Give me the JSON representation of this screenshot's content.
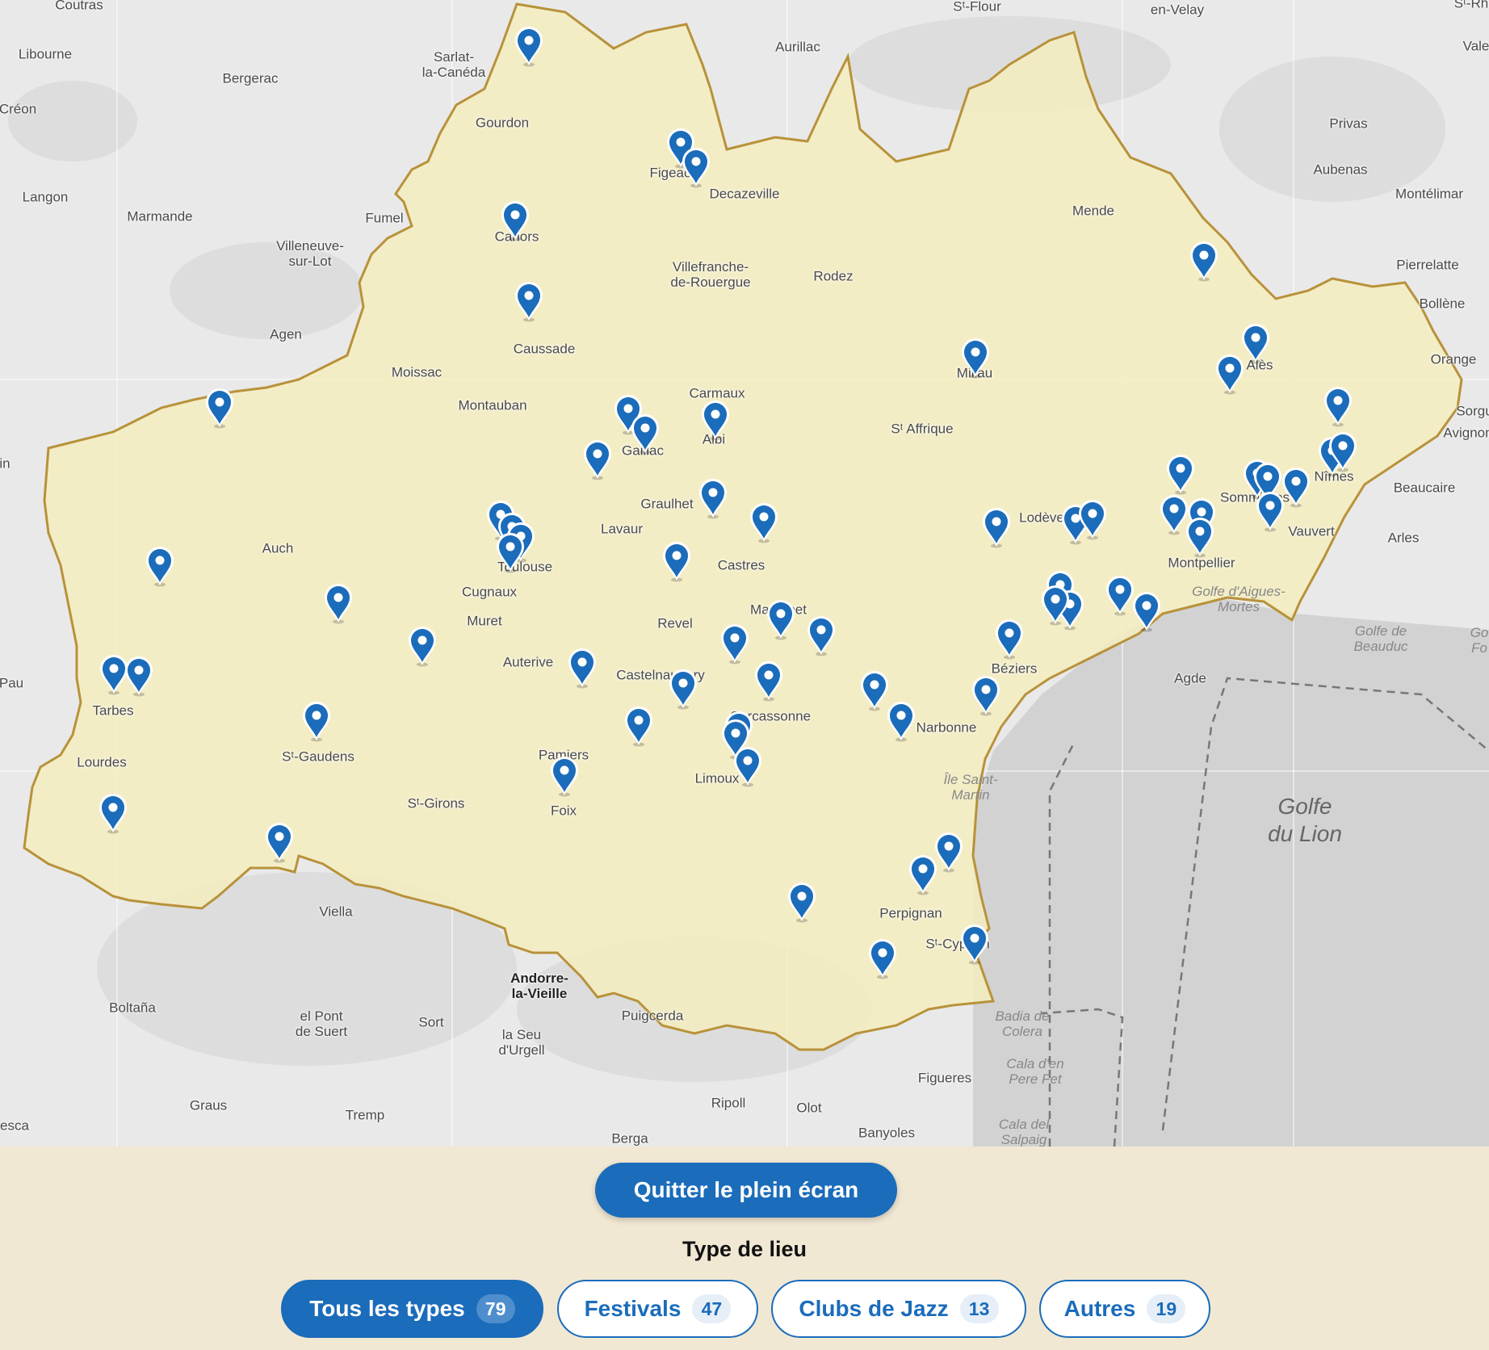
{
  "map": {
    "places": [
      {
        "name": "Coutras"
      },
      {
        "name": "Libourne"
      },
      {
        "name": "Créon"
      },
      {
        "name": "Bergerac"
      },
      {
        "name": "Sarlat-\nla-Canéda"
      },
      {
        "name": "Gourdon"
      },
      {
        "name": "Aurillac"
      },
      {
        "name": "Sᵗ-Flour"
      },
      {
        "name": "en-Velay"
      },
      {
        "name": "Privas"
      },
      {
        "name": "Aubenas"
      },
      {
        "name": "Montélimar"
      },
      {
        "name": "Langon"
      },
      {
        "name": "Marmande"
      },
      {
        "name": "Fumel"
      },
      {
        "name": "Villeneuve-\nsur-Lot"
      },
      {
        "name": "Figeac"
      },
      {
        "name": "Decazeville"
      },
      {
        "name": "Cahors"
      },
      {
        "name": "Villefranche-\nde-Rouergue"
      },
      {
        "name": "Rodez"
      },
      {
        "name": "Mende"
      },
      {
        "name": "Pierrelatte"
      },
      {
        "name": "Bollène"
      },
      {
        "name": "Orange"
      },
      {
        "name": "Agen"
      },
      {
        "name": "Caussade"
      },
      {
        "name": "Moissac"
      },
      {
        "name": "Montauban"
      },
      {
        "name": "Carmaux"
      },
      {
        "name": "Millau"
      },
      {
        "name": "Sᵗ Affrique"
      },
      {
        "name": "Avignon"
      },
      {
        "name": "Auch"
      },
      {
        "name": "Lavaur"
      },
      {
        "name": "Graulhet"
      },
      {
        "name": "Castres"
      },
      {
        "name": "Lodève"
      },
      {
        "name": "Sommières"
      },
      {
        "name": "Vauvert"
      },
      {
        "name": "Beaucaire"
      },
      {
        "name": "Arles"
      },
      {
        "name": "Cugnaux"
      },
      {
        "name": "Muret"
      },
      {
        "name": "Revel"
      },
      {
        "name": "Mazamet"
      },
      {
        "name": "Montpellier"
      },
      {
        "name": "Golfe d'Aigues-\nMortes"
      },
      {
        "name": "Golfe de\nBeauduc"
      },
      {
        "name": "Pau"
      },
      {
        "name": "Auterive"
      },
      {
        "name": "Castelnaudary"
      },
      {
        "name": "Agde"
      },
      {
        "name": "Béziers"
      },
      {
        "name": "Carcassonne"
      },
      {
        "name": "Narbonne"
      },
      {
        "name": "Lourdes"
      },
      {
        "name": "Sᵗ-Gaudens"
      },
      {
        "name": "Pamiers"
      },
      {
        "name": "Limoux"
      },
      {
        "name": "Sᵗ-Girons"
      },
      {
        "name": "Foix"
      },
      {
        "name": "Île Saint-\nMartin"
      },
      {
        "name": "Golfe\ndu Lion"
      },
      {
        "name": "Perpignan"
      },
      {
        "name": "Viella"
      },
      {
        "name": "Sᵗ-Cyprien"
      },
      {
        "name": "Andorre-\nla-Vieille"
      },
      {
        "name": "Boltaña"
      },
      {
        "name": "el Pont\nde Suert"
      },
      {
        "name": "Sort"
      },
      {
        "name": "la Seu\nd'Urgell"
      },
      {
        "name": "Puigcerda"
      },
      {
        "name": "Badia de\nColera"
      },
      {
        "name": "Figueres"
      },
      {
        "name": "Cala d'en\nPere Fet"
      },
      {
        "name": "Graus"
      },
      {
        "name": "Tremp"
      },
      {
        "name": "Ripoll"
      },
      {
        "name": "Olot"
      },
      {
        "name": "Banyoles"
      },
      {
        "name": "Cala del\nSalpaig"
      },
      {
        "name": "Berga"
      },
      {
        "name": "esca"
      },
      {
        "name": "Vale"
      },
      {
        "name": "Tarbes"
      },
      {
        "name": "Toulouse"
      },
      {
        "name": "Albi"
      },
      {
        "name": "Gaillac"
      },
      {
        "name": "Nîmes"
      },
      {
        "name": "Alès"
      },
      {
        "name": "Sᵗ-Rh"
      },
      {
        "name": "Sorgu"
      },
      {
        "name": "Go\nFo"
      },
      {
        "name": "in"
      }
    ],
    "marker_color": "#1b6cba",
    "region_fill": "#f5edc0",
    "region_border": "#b8923a"
  },
  "controls": {
    "fullscreen_button": "Quitter le plein écran",
    "filter_title": "Type de lieu",
    "filters": [
      {
        "label": "Tous les types",
        "count": "79",
        "active": true
      },
      {
        "label": "Festivals",
        "count": "47",
        "active": false
      },
      {
        "label": "Clubs de Jazz",
        "count": "13",
        "active": false
      },
      {
        "label": "Autres",
        "count": "19",
        "active": false
      }
    ]
  }
}
